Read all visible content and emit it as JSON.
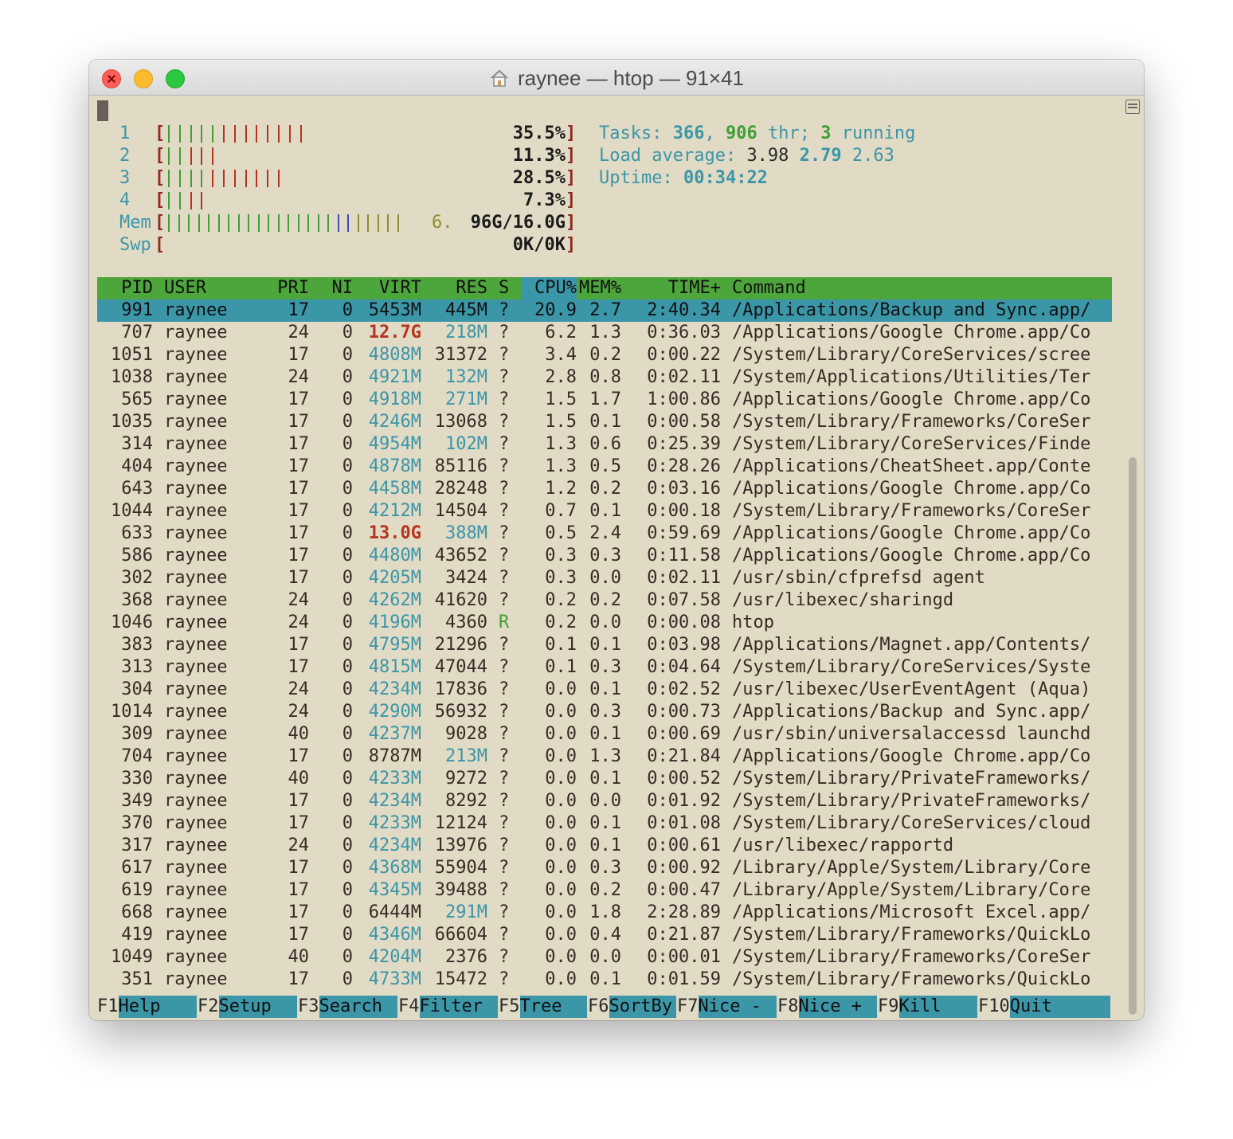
{
  "window": {
    "title": "raynee — htop — 91×41"
  },
  "meters": {
    "cpus": [
      {
        "num": "1",
        "pct": "35.5%",
        "bars": 13
      },
      {
        "num": "2",
        "pct": "11.3%",
        "bars": 5
      },
      {
        "num": "3",
        "pct": "28.5%",
        "bars": 11
      },
      {
        "num": "4",
        "pct": "7.3%",
        "bars": 4
      }
    ],
    "mem": {
      "label": "Mem",
      "value": "6.96G/16.0G",
      "prefix": "6.",
      "suffix": "96G/16.0G",
      "bars": 24
    },
    "swp": {
      "label": "Swp",
      "value": "0K/0K"
    },
    "open": "[",
    "close": "]"
  },
  "info": {
    "tasks_label": "Tasks: ",
    "tasks": "366",
    "sep1": ", ",
    "threads": "906",
    "thr_label": " thr; ",
    "running": "3",
    "running_label": " running",
    "load_label": "Load average: ",
    "load1": "3.98",
    "load5": "2.79",
    "load15": "2.63",
    "uptime_label": "Uptime: ",
    "uptime": "00:34:22"
  },
  "columns": {
    "pid": "PID",
    "user": "USER",
    "pri": "PRI",
    "ni": "NI",
    "virt": "VIRT",
    "res": "RES",
    "s": "S",
    "cpu": "CPU%",
    "mem": "MEM%",
    "time": "TIME+",
    "cmd": "Command"
  },
  "processes": [
    {
      "pid": "991",
      "user": "raynee",
      "pri": "17",
      "ni": "0",
      "virt": "5453M",
      "res": "445M",
      "s": "?",
      "cpu": "20.9",
      "mem": "2.7",
      "time": "2:40.34",
      "cmd": "/Applications/Backup and Sync.app/"
    },
    {
      "pid": "707",
      "user": "raynee",
      "pri": "24",
      "ni": "0",
      "virt": "12.7G",
      "res": "218M",
      "s": "?",
      "cpu": "6.2",
      "mem": "1.3",
      "time": "0:36.03",
      "cmd": "/Applications/Google Chrome.app/Co"
    },
    {
      "pid": "1051",
      "user": "raynee",
      "pri": "17",
      "ni": "0",
      "virt": "4808M",
      "res": "31372",
      "s": "?",
      "cpu": "3.4",
      "mem": "0.2",
      "time": "0:00.22",
      "cmd": "/System/Library/CoreServices/scree"
    },
    {
      "pid": "1038",
      "user": "raynee",
      "pri": "24",
      "ni": "0",
      "virt": "4921M",
      "res": "132M",
      "s": "?",
      "cpu": "2.8",
      "mem": "0.8",
      "time": "0:02.11",
      "cmd": "/System/Applications/Utilities/Ter"
    },
    {
      "pid": "565",
      "user": "raynee",
      "pri": "17",
      "ni": "0",
      "virt": "4918M",
      "res": "271M",
      "s": "?",
      "cpu": "1.5",
      "mem": "1.7",
      "time": "1:00.86",
      "cmd": "/Applications/Google Chrome.app/Co"
    },
    {
      "pid": "1035",
      "user": "raynee",
      "pri": "17",
      "ni": "0",
      "virt": "4246M",
      "res": "13068",
      "s": "?",
      "cpu": "1.5",
      "mem": "0.1",
      "time": "0:00.58",
      "cmd": "/System/Library/Frameworks/CoreSer"
    },
    {
      "pid": "314",
      "user": "raynee",
      "pri": "17",
      "ni": "0",
      "virt": "4954M",
      "res": "102M",
      "s": "?",
      "cpu": "1.3",
      "mem": "0.6",
      "time": "0:25.39",
      "cmd": "/System/Library/CoreServices/Finde"
    },
    {
      "pid": "404",
      "user": "raynee",
      "pri": "17",
      "ni": "0",
      "virt": "4878M",
      "res": "85116",
      "s": "?",
      "cpu": "1.3",
      "mem": "0.5",
      "time": "0:28.26",
      "cmd": "/Applications/CheatSheet.app/Conte"
    },
    {
      "pid": "643",
      "user": "raynee",
      "pri": "17",
      "ni": "0",
      "virt": "4458M",
      "res": "28248",
      "s": "?",
      "cpu": "1.2",
      "mem": "0.2",
      "time": "0:03.16",
      "cmd": "/Applications/Google Chrome.app/Co"
    },
    {
      "pid": "1044",
      "user": "raynee",
      "pri": "17",
      "ni": "0",
      "virt": "4212M",
      "res": "14504",
      "s": "?",
      "cpu": "0.7",
      "mem": "0.1",
      "time": "0:00.18",
      "cmd": "/System/Library/Frameworks/CoreSer"
    },
    {
      "pid": "633",
      "user": "raynee",
      "pri": "17",
      "ni": "0",
      "virt": "13.0G",
      "res": "388M",
      "s": "?",
      "cpu": "0.5",
      "mem": "2.4",
      "time": "0:59.69",
      "cmd": "/Applications/Google Chrome.app/Co"
    },
    {
      "pid": "586",
      "user": "raynee",
      "pri": "17",
      "ni": "0",
      "virt": "4480M",
      "res": "43652",
      "s": "?",
      "cpu": "0.3",
      "mem": "0.3",
      "time": "0:11.58",
      "cmd": "/Applications/Google Chrome.app/Co"
    },
    {
      "pid": "302",
      "user": "raynee",
      "pri": "17",
      "ni": "0",
      "virt": "4205M",
      "res": "3424",
      "s": "?",
      "cpu": "0.3",
      "mem": "0.0",
      "time": "0:02.11",
      "cmd": "/usr/sbin/cfprefsd agent"
    },
    {
      "pid": "368",
      "user": "raynee",
      "pri": "24",
      "ni": "0",
      "virt": "4262M",
      "res": "41620",
      "s": "?",
      "cpu": "0.2",
      "mem": "0.2",
      "time": "0:07.58",
      "cmd": "/usr/libexec/sharingd"
    },
    {
      "pid": "1046",
      "user": "raynee",
      "pri": "24",
      "ni": "0",
      "virt": "4196M",
      "res": "4360",
      "s": "R",
      "cpu": "0.2",
      "mem": "0.0",
      "time": "0:00.08",
      "cmd": "htop"
    },
    {
      "pid": "383",
      "user": "raynee",
      "pri": "17",
      "ni": "0",
      "virt": "4795M",
      "res": "21296",
      "s": "?",
      "cpu": "0.1",
      "mem": "0.1",
      "time": "0:03.98",
      "cmd": "/Applications/Magnet.app/Contents/"
    },
    {
      "pid": "313",
      "user": "raynee",
      "pri": "17",
      "ni": "0",
      "virt": "4815M",
      "res": "47044",
      "s": "?",
      "cpu": "0.1",
      "mem": "0.3",
      "time": "0:04.64",
      "cmd": "/System/Library/CoreServices/Syste"
    },
    {
      "pid": "304",
      "user": "raynee",
      "pri": "24",
      "ni": "0",
      "virt": "4234M",
      "res": "17836",
      "s": "?",
      "cpu": "0.0",
      "mem": "0.1",
      "time": "0:02.52",
      "cmd": "/usr/libexec/UserEventAgent (Aqua)"
    },
    {
      "pid": "1014",
      "user": "raynee",
      "pri": "24",
      "ni": "0",
      "virt": "4290M",
      "res": "56932",
      "s": "?",
      "cpu": "0.0",
      "mem": "0.3",
      "time": "0:00.73",
      "cmd": "/Applications/Backup and Sync.app/"
    },
    {
      "pid": "309",
      "user": "raynee",
      "pri": "40",
      "ni": "0",
      "virt": "4237M",
      "res": "9028",
      "s": "?",
      "cpu": "0.0",
      "mem": "0.1",
      "time": "0:00.69",
      "cmd": "/usr/sbin/universalaccessd launchd"
    },
    {
      "pid": "704",
      "user": "raynee",
      "pri": "17",
      "ni": "0",
      "virt": "8787M",
      "res": "213M",
      "s": "?",
      "cpu": "0.0",
      "mem": "1.3",
      "time": "0:21.84",
      "cmd": "/Applications/Google Chrome.app/Co"
    },
    {
      "pid": "330",
      "user": "raynee",
      "pri": "40",
      "ni": "0",
      "virt": "4233M",
      "res": "9272",
      "s": "?",
      "cpu": "0.0",
      "mem": "0.1",
      "time": "0:00.52",
      "cmd": "/System/Library/PrivateFrameworks/"
    },
    {
      "pid": "349",
      "user": "raynee",
      "pri": "17",
      "ni": "0",
      "virt": "4234M",
      "res": "8292",
      "s": "?",
      "cpu": "0.0",
      "mem": "0.0",
      "time": "0:01.92",
      "cmd": "/System/Library/PrivateFrameworks/"
    },
    {
      "pid": "370",
      "user": "raynee",
      "pri": "17",
      "ni": "0",
      "virt": "4233M",
      "res": "12124",
      "s": "?",
      "cpu": "0.0",
      "mem": "0.1",
      "time": "0:01.08",
      "cmd": "/System/Library/CoreServices/cloud"
    },
    {
      "pid": "317",
      "user": "raynee",
      "pri": "24",
      "ni": "0",
      "virt": "4234M",
      "res": "13976",
      "s": "?",
      "cpu": "0.0",
      "mem": "0.1",
      "time": "0:00.61",
      "cmd": "/usr/libexec/rapportd"
    },
    {
      "pid": "617",
      "user": "raynee",
      "pri": "17",
      "ni": "0",
      "virt": "4368M",
      "res": "55904",
      "s": "?",
      "cpu": "0.0",
      "mem": "0.3",
      "time": "0:00.92",
      "cmd": "/Library/Apple/System/Library/Core"
    },
    {
      "pid": "619",
      "user": "raynee",
      "pri": "17",
      "ni": "0",
      "virt": "4345M",
      "res": "39488",
      "s": "?",
      "cpu": "0.0",
      "mem": "0.2",
      "time": "0:00.47",
      "cmd": "/Library/Apple/System/Library/Core"
    },
    {
      "pid": "668",
      "user": "raynee",
      "pri": "17",
      "ni": "0",
      "virt": "6444M",
      "res": "291M",
      "s": "?",
      "cpu": "0.0",
      "mem": "1.8",
      "time": "2:28.89",
      "cmd": "/Applications/Microsoft Excel.app/"
    },
    {
      "pid": "419",
      "user": "raynee",
      "pri": "17",
      "ni": "0",
      "virt": "4346M",
      "res": "66604",
      "s": "?",
      "cpu": "0.0",
      "mem": "0.4",
      "time": "0:21.87",
      "cmd": "/System/Library/Frameworks/QuickLo"
    },
    {
      "pid": "1049",
      "user": "raynee",
      "pri": "40",
      "ni": "0",
      "virt": "4204M",
      "res": "2376",
      "s": "?",
      "cpu": "0.0",
      "mem": "0.0",
      "time": "0:00.01",
      "cmd": "/System/Library/Frameworks/CoreSer"
    },
    {
      "pid": "351",
      "user": "raynee",
      "pri": "17",
      "ni": "0",
      "virt": "4733M",
      "res": "15472",
      "s": "?",
      "cpu": "0.0",
      "mem": "0.1",
      "time": "0:01.59",
      "cmd": "/System/Library/Frameworks/QuickLo"
    }
  ],
  "fkeys": [
    {
      "key": "F1",
      "label": "Help  "
    },
    {
      "key": "F2",
      "label": "Setup "
    },
    {
      "key": "F3",
      "label": "Search"
    },
    {
      "key": "F4",
      "label": "Filter"
    },
    {
      "key": "F5",
      "label": "Tree  "
    },
    {
      "key": "F6",
      "label": "SortBy"
    },
    {
      "key": "F7",
      "label": "Nice -"
    },
    {
      "key": "F8",
      "label": "Nice +"
    },
    {
      "key": "F9",
      "label": "Kill  "
    },
    {
      "key": "F10",
      "label": "Quit   "
    }
  ],
  "colors": {
    "teal": "#3b96a8",
    "green": "#4da63b",
    "red": "#b5341f",
    "background": "#e1dac5"
  }
}
